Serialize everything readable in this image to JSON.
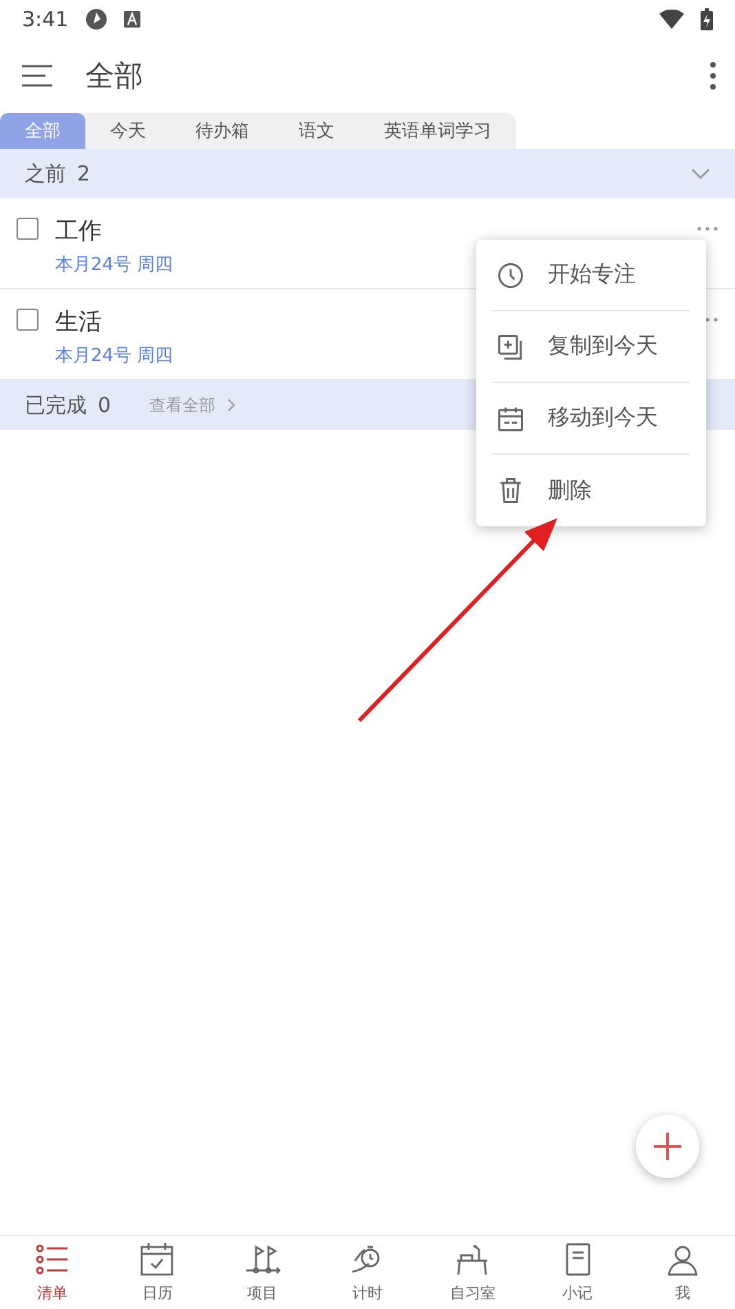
{
  "status_bar": {
    "time": "3:41"
  },
  "app_bar": {
    "title": "全部"
  },
  "tabs": [
    {
      "label": "全部",
      "selected": true
    },
    {
      "label": "今天",
      "selected": false
    },
    {
      "label": "待办箱",
      "selected": false
    },
    {
      "label": "语文",
      "selected": false
    },
    {
      "label": "英语单词学习",
      "selected": false
    }
  ],
  "sections": [
    {
      "title": "之前",
      "count": "2",
      "tasks": [
        {
          "title": "工作",
          "date": "本月24号 周四",
          "checked": false
        },
        {
          "title": "生活",
          "date": "本月24号 周四",
          "checked": false
        }
      ]
    }
  ],
  "completed": {
    "title": "已完成",
    "count": "0",
    "link": "查看全部"
  },
  "context_menu": [
    {
      "kind": "clock",
      "label": "开始专注"
    },
    {
      "kind": "copy",
      "label": "复制到今天"
    },
    {
      "kind": "calendar",
      "label": "移动到今天"
    },
    {
      "kind": "trash",
      "label": "删除"
    }
  ],
  "bottom_nav": [
    {
      "kind": "list",
      "label": "清单",
      "selected": true
    },
    {
      "kind": "calendar",
      "label": "日历",
      "selected": false
    },
    {
      "kind": "flags",
      "label": "项目",
      "selected": false
    },
    {
      "kind": "timer",
      "label": "计时",
      "selected": false
    },
    {
      "kind": "desk",
      "label": "自习室",
      "selected": false
    },
    {
      "kind": "note",
      "label": "小记",
      "selected": false
    },
    {
      "kind": "person",
      "label": "我",
      "selected": false
    }
  ]
}
